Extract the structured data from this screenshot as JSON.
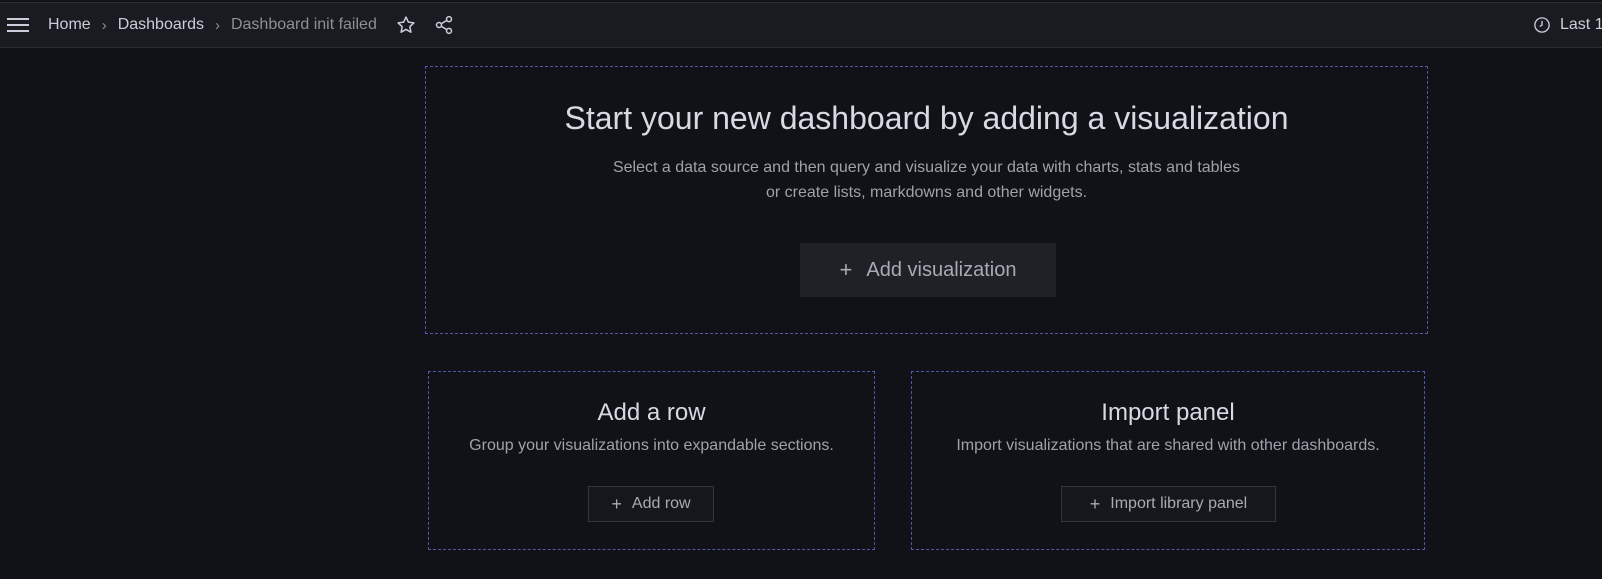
{
  "topbar": {
    "breadcrumbs": [
      "Home",
      "Dashboards",
      "Dashboard init failed"
    ],
    "separator": "›",
    "time_range_label": "Last 1"
  },
  "icons": {
    "menu": "hamburger-menu-icon",
    "star": "star-icon",
    "share": "share-icon",
    "clock": "clock-icon",
    "plus": "plus-icon"
  },
  "empty_dashboard": {
    "title": "Start your new dashboard by adding a visualization",
    "description_line1": "Select a data source and then query and visualize your data with charts, stats and tables",
    "description_line2": "or create lists, markdowns and other widgets.",
    "add_visualization_label": "Add visualization"
  },
  "add_row_card": {
    "title": "Add a row",
    "description": "Group your visualizations into expandable sections.",
    "button_label": "Add row"
  },
  "import_panel_card": {
    "title": "Import panel",
    "description": "Import visualizations that are shared with other dashboards.",
    "button_label": "Import library panel"
  },
  "colors": {
    "background": "#111217",
    "topbar": "#181b1f",
    "dashed_border": "#4c5ba8",
    "text_primary": "#d8d9e3",
    "text_secondary": "#a0a1ab"
  }
}
